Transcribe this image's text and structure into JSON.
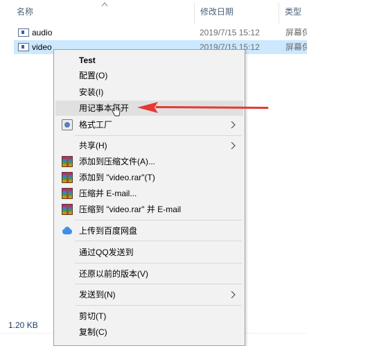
{
  "header": {
    "col_name": "名称",
    "col_date": "修改日期",
    "col_type": "类型"
  },
  "files": [
    {
      "name": "audio",
      "date": "2019/7/15 15:12",
      "type": "屏幕保护程序",
      "selected": false
    },
    {
      "name": "video",
      "date": "2019/7/15 15:12",
      "type": "屏幕保护程序",
      "selected": true
    }
  ],
  "status": {
    "size": "1.20 KB"
  },
  "context_menu": {
    "test": "Test",
    "configure": "配置(O)",
    "install": "安装(I)",
    "open_with_notepad": "用记事本打开",
    "format_factory": "格式工厂",
    "share": "共享(H)",
    "add_to_archive": "添加到压缩文件(A)...",
    "add_to_rar": "添加到 \"video.rar\"(T)",
    "compress_email": "压缩并 E-mail...",
    "compress_rar_email": "压缩到 \"video.rar\" 并 E-mail",
    "upload_baidu": "上传到百度网盘",
    "send_qq": "通过QQ发送到",
    "restore_previous": "还原以前的版本(V)",
    "send_to": "发送到(N)",
    "cut": "剪切(T)",
    "copy": "复制(C)"
  },
  "colors": {
    "selection": "#cce8ff",
    "menu_bg": "#f2f2f2",
    "menu_hover": "#e0e0e0",
    "annotation_arrow": "#e53935"
  }
}
